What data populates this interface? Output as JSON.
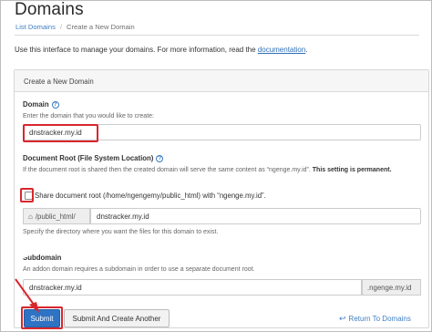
{
  "page": {
    "title": "Domains"
  },
  "breadcrumb": {
    "items": [
      "List Domains",
      "Create a New Domain"
    ],
    "separator": "/"
  },
  "intro": {
    "text": "Use this interface to manage your domains. For more information, read the ",
    "link": "documentation",
    "suffix": "."
  },
  "panel": {
    "heading": "Create a New Domain"
  },
  "domain": {
    "label": "Domain",
    "hint": "Enter the domain that you would like to create:",
    "value": "dnstracker.my.id"
  },
  "document_root": {
    "label": "Document Root (File System Location)",
    "hint_prefix": "If the document root is shared then the created domain will serve the same content as “ngenge.my.id”.",
    "hint_bold": "This setting is permanent.",
    "share_checkbox_label": "Share document root (/home/ngengemy/public_html) with “ngenge.my.id”.",
    "share_checked": false,
    "path_prefix": "/public_html/",
    "path_value": "dnstracker.my.id",
    "path_hint": "Specify the directory where you want the files for this domain to exist."
  },
  "subdomain": {
    "label": "Subdomain",
    "hint": "An addon domain requires a subdomain in order to use a separate document root.",
    "value": "dnstracker.my.id",
    "suffix": ".ngenge.my.id"
  },
  "actions": {
    "submit": "Submit",
    "submit_another": "Submit And Create Another",
    "return": "Return To Domains"
  },
  "icons": {
    "help": "help-circle-icon",
    "home": "home-icon",
    "return": "arrow-left-icon"
  },
  "colors": {
    "annotation_red": "#d8272d",
    "primary": "#2f73c4",
    "link": "#3f7fc2"
  }
}
